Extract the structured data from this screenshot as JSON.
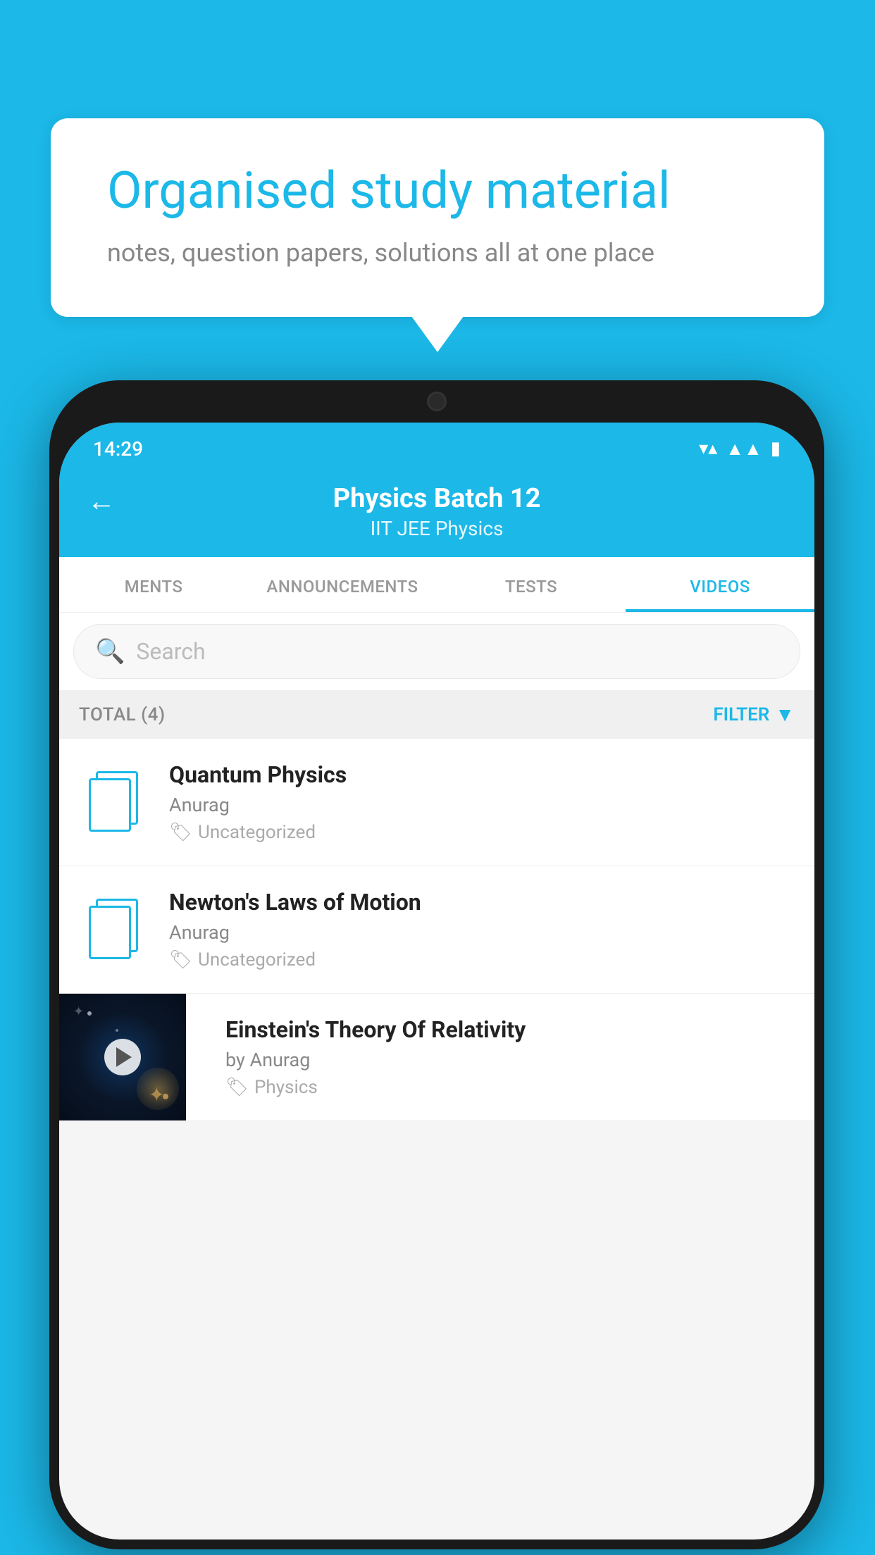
{
  "background": {
    "color": "#1BB8E8"
  },
  "speech_bubble": {
    "title": "Organised study material",
    "subtitle": "notes, question papers, solutions all at one place"
  },
  "phone": {
    "status_bar": {
      "time": "14:29"
    },
    "header": {
      "back_label": "←",
      "title": "Physics Batch 12",
      "subtitle_tags": "IIT JEE    Physics"
    },
    "tabs": [
      {
        "label": "MENTS",
        "active": false
      },
      {
        "label": "ANNOUNCEMENTS",
        "active": false
      },
      {
        "label": "TESTS",
        "active": false
      },
      {
        "label": "VIDEOS",
        "active": true
      }
    ],
    "search": {
      "placeholder": "Search"
    },
    "filter_bar": {
      "total_label": "TOTAL (4)",
      "filter_label": "FILTER"
    },
    "videos": [
      {
        "title": "Quantum Physics",
        "author": "Anurag",
        "tag": "Uncategorized",
        "has_thumbnail": false
      },
      {
        "title": "Newton's Laws of Motion",
        "author": "Anurag",
        "tag": "Uncategorized",
        "has_thumbnail": false
      },
      {
        "title": "Einstein's Theory Of Relativity",
        "author": "by Anurag",
        "tag": "Physics",
        "has_thumbnail": true
      }
    ]
  }
}
